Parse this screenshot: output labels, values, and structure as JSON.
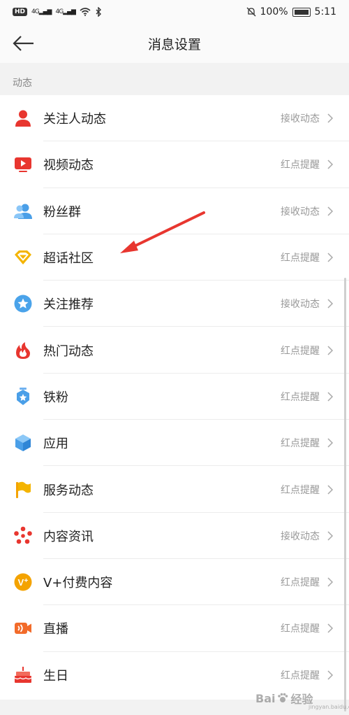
{
  "status_bar": {
    "hd": "HD",
    "sig1": "4G",
    "sig2": "4G",
    "battery": "100%",
    "time": "5:11"
  },
  "header": {
    "title": "消息设置"
  },
  "section": {
    "title": "动态"
  },
  "items": [
    {
      "label": "关注人动态",
      "value": "接收动态",
      "icon": "person-icon"
    },
    {
      "label": "视频动态",
      "value": "红点提醒",
      "icon": "video-icon"
    },
    {
      "label": "粉丝群",
      "value": "接收动态",
      "icon": "fans-group-icon"
    },
    {
      "label": "超话社区",
      "value": "红点提醒",
      "icon": "diamond-icon"
    },
    {
      "label": "关注推荐",
      "value": "接收动态",
      "icon": "star-badge-icon"
    },
    {
      "label": "热门动态",
      "value": "红点提醒",
      "icon": "flame-icon"
    },
    {
      "label": "铁粉",
      "value": "红点提醒",
      "icon": "medal-icon"
    },
    {
      "label": "应用",
      "value": "红点提醒",
      "icon": "cube-icon"
    },
    {
      "label": "服务动态",
      "value": "红点提醒",
      "icon": "flag-icon"
    },
    {
      "label": "内容资讯",
      "value": "接收动态",
      "icon": "flower-icon"
    },
    {
      "label": "V+付费内容",
      "value": "红点提醒",
      "icon": "vplus-icon"
    },
    {
      "label": "直播",
      "value": "红点提醒",
      "icon": "live-camera-icon"
    },
    {
      "label": "生日",
      "value": "红点提醒",
      "icon": "cake-icon"
    }
  ],
  "watermark": {
    "brand": "Bai",
    "brand2": "经验",
    "sub": "jingyan.baidu.com"
  },
  "colors": {
    "accent_red": "#e8362f",
    "annotation_red": "#e8362f",
    "text_gray": "#999999"
  }
}
